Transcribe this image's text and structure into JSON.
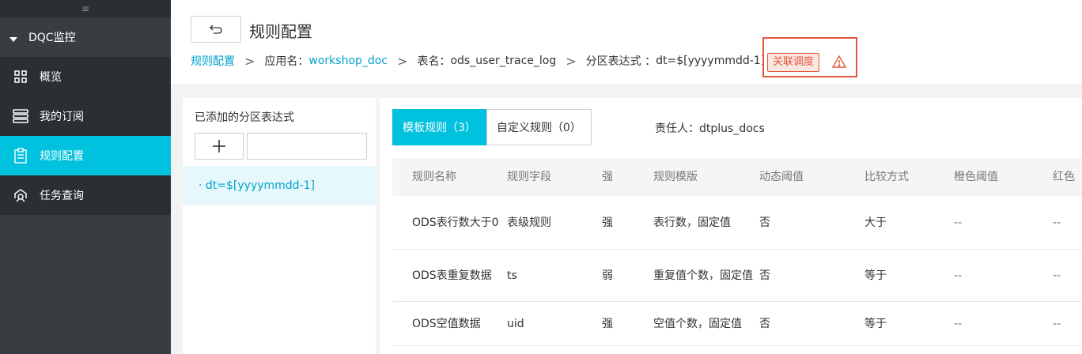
{
  "sidebar": {
    "collapse_glyph": "≡",
    "section_title": "DQC监控",
    "items": [
      {
        "label": "概览",
        "icon": "grid-icon"
      },
      {
        "label": "我的订阅",
        "icon": "server-stack-icon"
      },
      {
        "label": "规则配置",
        "icon": "clipboard-icon",
        "active": true
      },
      {
        "label": "任务查询",
        "icon": "search-task-icon"
      }
    ]
  },
  "header": {
    "back_icon": "undo-arrow-icon",
    "title": "规则配置",
    "breadcrumb": {
      "root": "规则配置",
      "app_prefix": "应用名：",
      "app_name": "workshop_doc",
      "table_prefix": "表名：",
      "table_name": "ods_user_trace_log",
      "partition_prefix": "分区表达式 ：",
      "partition_value": "dt=$[yyyymmdd-1]"
    },
    "schedule_tag": "关联调度",
    "warning_icon": "warning-triangle-icon"
  },
  "left_panel": {
    "title": "已添加的分区表达式",
    "add_label": "+",
    "input_value": "",
    "items": [
      "· dt=$[yyyymmdd-1]"
    ]
  },
  "right_panel": {
    "tabs": [
      {
        "label": "模板规则（3）",
        "active": true
      },
      {
        "label": "自定义规则（0）",
        "active": false
      }
    ],
    "owner": "责任人：dtplus_docs",
    "columns": [
      "规则名称",
      "规则字段",
      "强",
      "规则模版",
      "动态阈值",
      "比较方式",
      "橙色阈值",
      "红色"
    ],
    "rows": [
      {
        "name": "ODS表行数大于0",
        "field": "表级规则",
        "strength": "强",
        "template": "表行数，固定值",
        "dynamic": "否",
        "compare": "大于",
        "orange": "--",
        "red": "--"
      },
      {
        "name": "ODS表重复数据",
        "field": "ts",
        "strength": "弱",
        "template": "重复值个数，固定值",
        "dynamic": "否",
        "compare": "等于",
        "orange": "--",
        "red": "--"
      },
      {
        "name": "ODS空值数据",
        "field": "uid",
        "strength": "强",
        "template": "空值个数，固定值",
        "dynamic": "否",
        "compare": "等于",
        "orange": "--",
        "red": "--"
      }
    ]
  },
  "colors": {
    "accent": "#00c1de",
    "link": "#00a2ca",
    "sidebar_bg": "#373d41",
    "sidebar_item_bg": "#2a2f32",
    "warning": "#e4583a"
  }
}
